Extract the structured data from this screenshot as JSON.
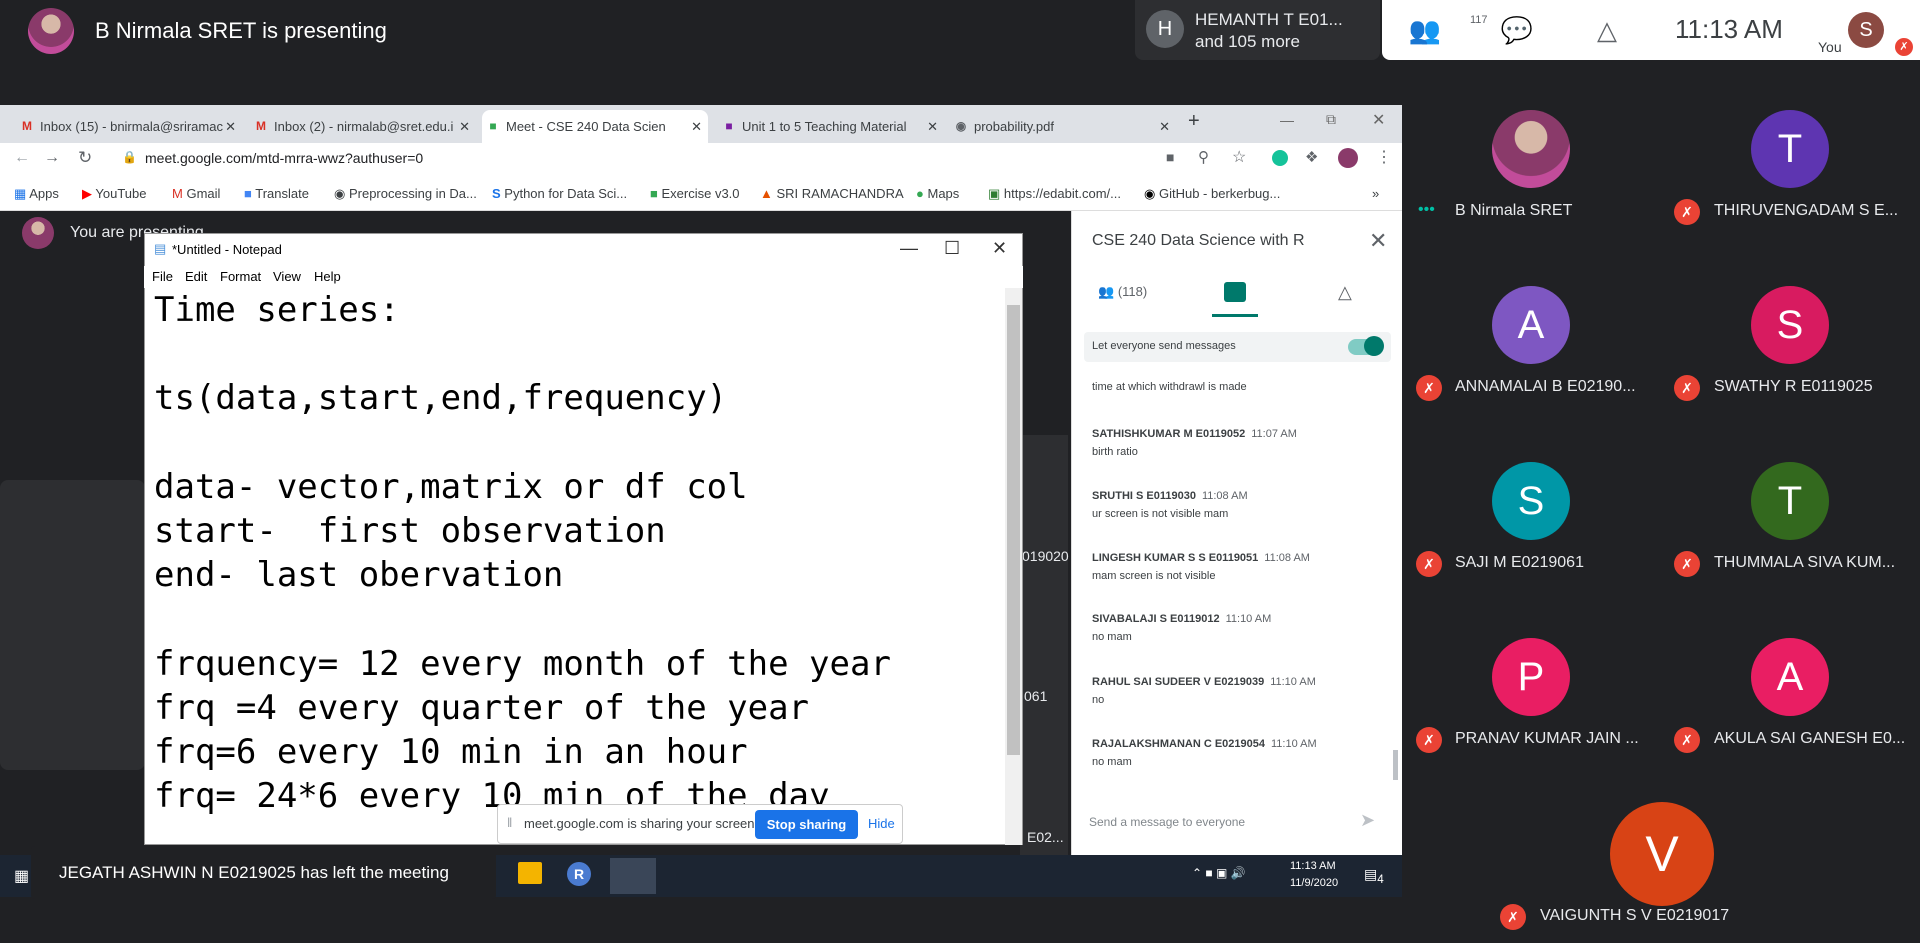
{
  "meet": {
    "presenter_banner": "B Nirmala SRET is presenting",
    "raised_hand_avatar": "H",
    "raised_line1": "HEMANTH T E01...",
    "raised_line2": "and 105 more",
    "participants_count": "117",
    "clock": "11:13 AM",
    "you_avatar": "S",
    "you_label": "You",
    "you_are_presenting": "You are presenting"
  },
  "browser": {
    "tabs": [
      {
        "label": "Inbox (15) - bnirmala@sriramac",
        "icon": "gmail-icon"
      },
      {
        "label": "Inbox (2) - nirmalab@sret.edu.i",
        "icon": "gmail-icon"
      },
      {
        "label": "Meet - CSE 240 Data Scien",
        "icon": "meet-icon"
      },
      {
        "label": "Unit 1 to 5 Teaching Material",
        "icon": "classroom-icon"
      },
      {
        "label": "probability.pdf",
        "icon": "globe-icon"
      }
    ],
    "url": "meet.google.com/mtd-mrra-wwz?authuser=0",
    "bookmarks": [
      "Apps",
      "YouTube",
      "Gmail",
      "Translate",
      "Preprocessing in Da...",
      "Python for Data Sci...",
      "Exercise v3.0",
      "SRI RAMACHANDRA",
      "Maps",
      "https://edabit.com/...",
      "GitHub - berkerbug..."
    ]
  },
  "notepad": {
    "title": "*Untitled - Notepad",
    "menu": [
      "File",
      "Edit",
      "Format",
      "View",
      "Help"
    ],
    "text": "Time series:\n\nts(data,start,end,frequency)\n\ndata- vector,matrix or df col\nstart-  first observation\nend- last obervation\n\nfrquency= 12 every month of the year\nfrq =4 every quarter of the year\nfrq=6 every 10 min in an hour\nfrq= 24*6 every 10 min of the day"
  },
  "sharebar": {
    "text": "meet.google.com is sharing your screen.",
    "stop": "Stop sharing",
    "hide": "Hide"
  },
  "chat": {
    "title": "CSE 240 Data Science with R",
    "people_count": "(118)",
    "let_everyone": "Let everyone send messages",
    "first_line": "time at which withdrawl is made",
    "messages": [
      {
        "name": "SATHISHKUMAR M E0119052",
        "time": "11:07 AM",
        "text": "birth ratio"
      },
      {
        "name": "SRUTHI S E0119030",
        "time": "11:08 AM",
        "text": "ur screen is not visible mam"
      },
      {
        "name": "LINGESH KUMAR S S E0119051",
        "time": "11:08 AM",
        "text": "mam screen is not visible"
      },
      {
        "name": "SIVABALAJI S E0119012",
        "time": "11:10 AM",
        "text": "no mam"
      },
      {
        "name": "RAHUL SAI SUDEER V E0219039",
        "time": "11:10 AM",
        "text": "no"
      },
      {
        "name": "RAJALAKSHMANAN C E0219054",
        "time": "11:10 AM",
        "text": "no mam"
      }
    ],
    "input_placeholder": "Send a message to everyone"
  },
  "bg_tiles": {
    "a": "019020",
    "b": "061",
    "c": "E02..."
  },
  "toast": "JEGATH ASHWIN N E0219025 has left the meeting",
  "taskbar": {
    "time": "11:13 AM",
    "date": "11/9/2020",
    "notif": "4"
  },
  "participants": [
    {
      "initial": "",
      "name": "B Nirmala SRET",
      "color": "#8a3a6a"
    },
    {
      "initial": "T",
      "name": "THIRUVENGADAM S E...",
      "color": "#5e35b1"
    },
    {
      "initial": "A",
      "name": "ANNAMALAI B E02190...",
      "color": "#7e57c2"
    },
    {
      "initial": "S",
      "name": "SWATHY R E0119025",
      "color": "#d81b60"
    },
    {
      "initial": "S",
      "name": "SAJI M E0219061",
      "color": "#0097a7"
    },
    {
      "initial": "T",
      "name": "THUMMALA SIVA KUM...",
      "color": "#33691e"
    },
    {
      "initial": "P",
      "name": "PRANAV KUMAR JAIN ...",
      "color": "#e91e63"
    },
    {
      "initial": "A",
      "name": "AKULA SAI GANESH E0...",
      "color": "#e91e63"
    },
    {
      "initial": "V",
      "name": "VAIGUNTH S V E0219017",
      "color": "#d84315"
    }
  ]
}
